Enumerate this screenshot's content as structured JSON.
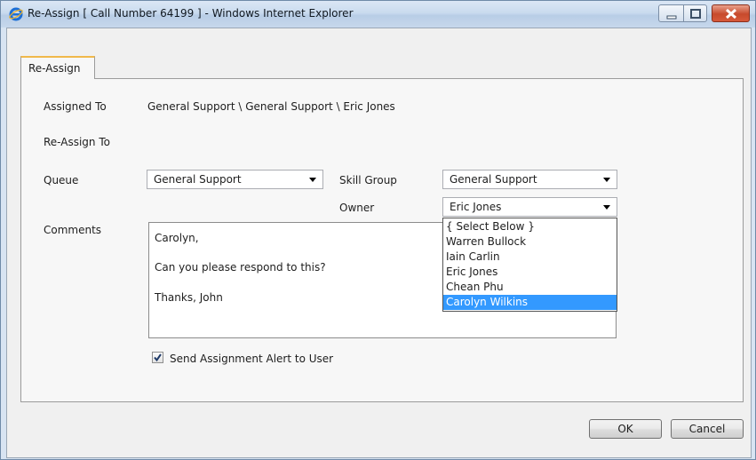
{
  "window": {
    "title": "Re-Assign [ Call Number 64199 ] - Windows Internet Explorer",
    "icon": "ie-icon",
    "controls": [
      "minimize-icon",
      "maximize-icon",
      "close-icon"
    ]
  },
  "tab": {
    "label": "Re-Assign"
  },
  "form": {
    "assigned_to_label": "Assigned To",
    "assigned_to_value": "General Support \\ General Support \\ Eric Jones",
    "reassign_to_label": "Re-Assign To",
    "queue_label": "Queue",
    "queue_value": "General Support",
    "skill_group_label": "Skill Group",
    "skill_group_value": "General Support",
    "owner_label": "Owner",
    "owner_value": "Eric Jones",
    "owner_options": [
      "{ Select Below }",
      "Warren Bullock",
      "Iain Carlin",
      "Eric Jones",
      "Chean Phu",
      "Carolyn Wilkins"
    ],
    "owner_highlighted": "Carolyn Wilkins",
    "comments_label": "Comments",
    "comments_lines": [
      "Carolyn,",
      "Can you please respond to this?",
      "Thanks, John"
    ],
    "alert_label": "Send Assignment Alert to User",
    "alert_checked": true
  },
  "buttons": {
    "ok": "OK",
    "cancel": "Cancel"
  },
  "colors": {
    "highlight": "#3399ff",
    "tab_accent": "#f0b84a",
    "close_button": "#c74a2c"
  }
}
